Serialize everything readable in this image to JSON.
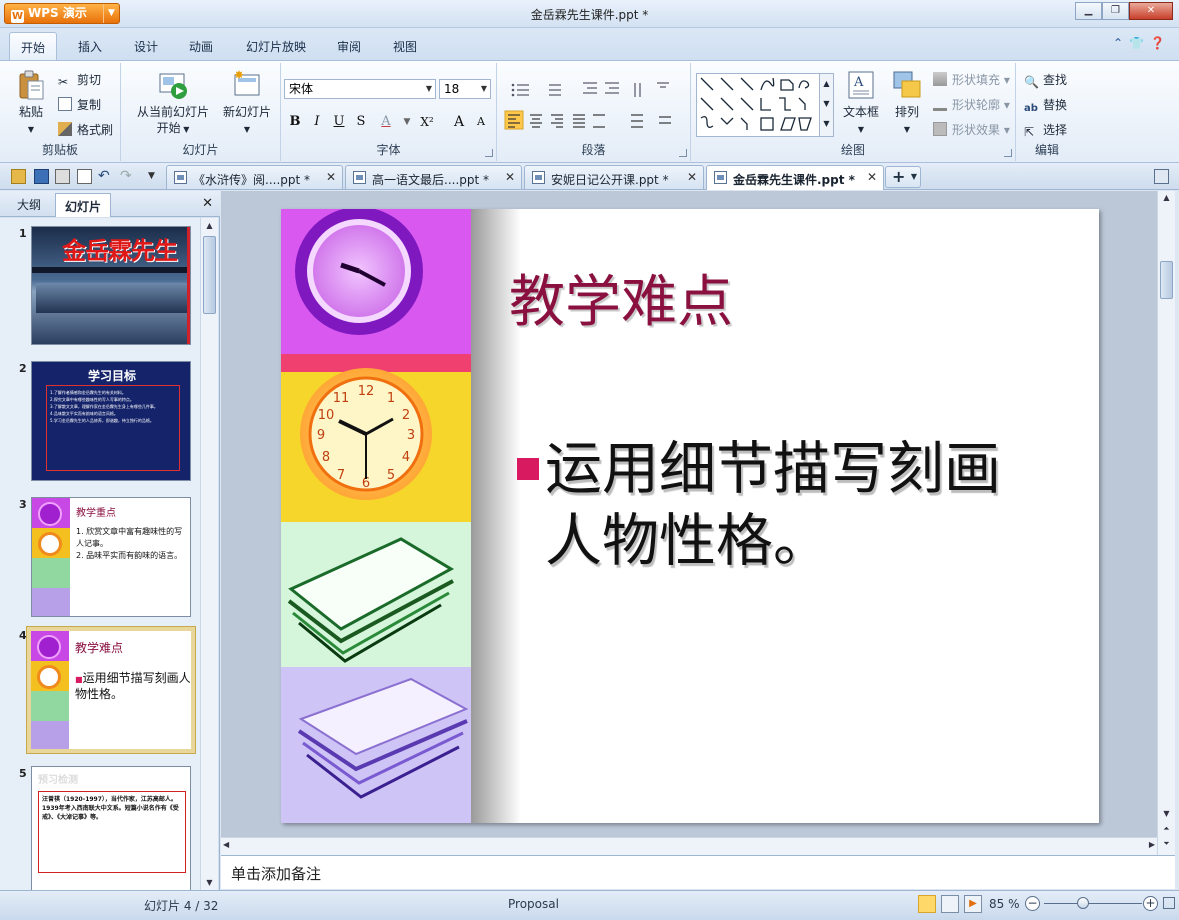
{
  "app": {
    "name": "WPS 演示",
    "document_title": "金岳霖先生课件.ppt *"
  },
  "ribbon_tabs": [
    "开始",
    "插入",
    "设计",
    "动画",
    "幻灯片放映",
    "审阅",
    "视图"
  ],
  "clipboard": {
    "paste": "粘贴",
    "cut": "剪切",
    "copy": "复制",
    "format_painter": "格式刷",
    "group": "剪贴板"
  },
  "slides_group": {
    "from_current": "从当前幻灯片",
    "start": "开始",
    "new_slide": "新幻灯片",
    "group": "幻灯片"
  },
  "font": {
    "name": "宋体",
    "size": "18",
    "bold": "B",
    "italic": "I",
    "underline": "U",
    "shadow": "S",
    "color": "A",
    "superscript": "X²",
    "grow": "A",
    "shrink": "A",
    "group": "字体"
  },
  "paragraph": {
    "group": "段落"
  },
  "drawing": {
    "textbox": "文本框",
    "arrange": "排列",
    "shape_fill": "形状填充",
    "shape_outline": "形状轮廓",
    "shape_effect": "形状效果",
    "group": "绘图"
  },
  "editing": {
    "find": "查找",
    "replace": "替换",
    "select": "选择",
    "group": "编辑"
  },
  "doc_tabs": [
    {
      "label": "《水浒传》阅....ppt *"
    },
    {
      "label": "高一语文最后....ppt *"
    },
    {
      "label": "安妮日记公开课.ppt *"
    },
    {
      "label": "金岳霖先生课件.ppt *"
    }
  ],
  "left_panel": {
    "tabs": [
      "大纲",
      "幻灯片"
    ]
  },
  "thumbnails": [
    {
      "num": "1",
      "title": "金岳霖先生"
    },
    {
      "num": "2",
      "title": "学习目标",
      "lines": [
        "1.了解作者情感和金岳霖先生的有关材料。",
        "2.探究文章中有哪些趣味性的写人写事的特点。",
        "3.了解散文文章，理解作家在金岳霖先生身上有哪些几件事。",
        "4.品味散文平实而有韵味的语言风格。",
        "5.学习金岳霖先生的人品修养，即谐趣，待立独行的品格。"
      ]
    },
    {
      "num": "3",
      "title": "教学重点",
      "bullets": [
        "1. 欣赏文章中富有趣味性的写人记事。",
        "2. 品味平实而有韵味的语言。"
      ]
    },
    {
      "num": "4",
      "title": "教学难点",
      "bullets": [
        "运用细节描写刻画人物性格。"
      ]
    },
    {
      "num": "5",
      "title": "预习检测",
      "extra": "汪曾祺（1920-1997），当代作家，江苏高邮人。1939年考入西南联大中文系。短篇小说名作有《受戒》、《大淖记事》等。"
    }
  ],
  "slide": {
    "title": "教学难点",
    "bullet": "运用细节描写刻画人物性格。",
    "bullet_line1": "运用细节描写刻画",
    "bullet_line2": "人物性格。"
  },
  "notes_placeholder": "单击添加备注",
  "status": {
    "slide_info": "幻灯片 4 / 32",
    "theme": "Proposal",
    "zoom": "85 %"
  },
  "colors": {
    "accent": "#f08a1c",
    "slide_title": "#8a1040",
    "bullet_marker": "#d81b60",
    "selection": "#ffc84a"
  }
}
